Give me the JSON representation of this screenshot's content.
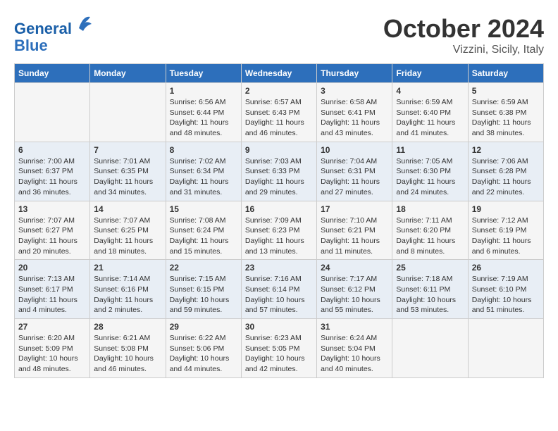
{
  "header": {
    "logo_line1": "General",
    "logo_line2": "Blue",
    "month": "October 2024",
    "location": "Vizzini, Sicily, Italy"
  },
  "weekdays": [
    "Sunday",
    "Monday",
    "Tuesday",
    "Wednesday",
    "Thursday",
    "Friday",
    "Saturday"
  ],
  "weeks": [
    [
      {
        "day": "",
        "info": ""
      },
      {
        "day": "",
        "info": ""
      },
      {
        "day": "1",
        "info": "Sunrise: 6:56 AM\nSunset: 6:44 PM\nDaylight: 11 hours\nand 48 minutes."
      },
      {
        "day": "2",
        "info": "Sunrise: 6:57 AM\nSunset: 6:43 PM\nDaylight: 11 hours\nand 46 minutes."
      },
      {
        "day": "3",
        "info": "Sunrise: 6:58 AM\nSunset: 6:41 PM\nDaylight: 11 hours\nand 43 minutes."
      },
      {
        "day": "4",
        "info": "Sunrise: 6:59 AM\nSunset: 6:40 PM\nDaylight: 11 hours\nand 41 minutes."
      },
      {
        "day": "5",
        "info": "Sunrise: 6:59 AM\nSunset: 6:38 PM\nDaylight: 11 hours\nand 38 minutes."
      }
    ],
    [
      {
        "day": "6",
        "info": "Sunrise: 7:00 AM\nSunset: 6:37 PM\nDaylight: 11 hours\nand 36 minutes."
      },
      {
        "day": "7",
        "info": "Sunrise: 7:01 AM\nSunset: 6:35 PM\nDaylight: 11 hours\nand 34 minutes."
      },
      {
        "day": "8",
        "info": "Sunrise: 7:02 AM\nSunset: 6:34 PM\nDaylight: 11 hours\nand 31 minutes."
      },
      {
        "day": "9",
        "info": "Sunrise: 7:03 AM\nSunset: 6:33 PM\nDaylight: 11 hours\nand 29 minutes."
      },
      {
        "day": "10",
        "info": "Sunrise: 7:04 AM\nSunset: 6:31 PM\nDaylight: 11 hours\nand 27 minutes."
      },
      {
        "day": "11",
        "info": "Sunrise: 7:05 AM\nSunset: 6:30 PM\nDaylight: 11 hours\nand 24 minutes."
      },
      {
        "day": "12",
        "info": "Sunrise: 7:06 AM\nSunset: 6:28 PM\nDaylight: 11 hours\nand 22 minutes."
      }
    ],
    [
      {
        "day": "13",
        "info": "Sunrise: 7:07 AM\nSunset: 6:27 PM\nDaylight: 11 hours\nand 20 minutes."
      },
      {
        "day": "14",
        "info": "Sunrise: 7:07 AM\nSunset: 6:25 PM\nDaylight: 11 hours\nand 18 minutes."
      },
      {
        "day": "15",
        "info": "Sunrise: 7:08 AM\nSunset: 6:24 PM\nDaylight: 11 hours\nand 15 minutes."
      },
      {
        "day": "16",
        "info": "Sunrise: 7:09 AM\nSunset: 6:23 PM\nDaylight: 11 hours\nand 13 minutes."
      },
      {
        "day": "17",
        "info": "Sunrise: 7:10 AM\nSunset: 6:21 PM\nDaylight: 11 hours\nand 11 minutes."
      },
      {
        "day": "18",
        "info": "Sunrise: 7:11 AM\nSunset: 6:20 PM\nDaylight: 11 hours\nand 8 minutes."
      },
      {
        "day": "19",
        "info": "Sunrise: 7:12 AM\nSunset: 6:19 PM\nDaylight: 11 hours\nand 6 minutes."
      }
    ],
    [
      {
        "day": "20",
        "info": "Sunrise: 7:13 AM\nSunset: 6:17 PM\nDaylight: 11 hours\nand 4 minutes."
      },
      {
        "day": "21",
        "info": "Sunrise: 7:14 AM\nSunset: 6:16 PM\nDaylight: 11 hours\nand 2 minutes."
      },
      {
        "day": "22",
        "info": "Sunrise: 7:15 AM\nSunset: 6:15 PM\nDaylight: 10 hours\nand 59 minutes."
      },
      {
        "day": "23",
        "info": "Sunrise: 7:16 AM\nSunset: 6:14 PM\nDaylight: 10 hours\nand 57 minutes."
      },
      {
        "day": "24",
        "info": "Sunrise: 7:17 AM\nSunset: 6:12 PM\nDaylight: 10 hours\nand 55 minutes."
      },
      {
        "day": "25",
        "info": "Sunrise: 7:18 AM\nSunset: 6:11 PM\nDaylight: 10 hours\nand 53 minutes."
      },
      {
        "day": "26",
        "info": "Sunrise: 7:19 AM\nSunset: 6:10 PM\nDaylight: 10 hours\nand 51 minutes."
      }
    ],
    [
      {
        "day": "27",
        "info": "Sunrise: 6:20 AM\nSunset: 5:09 PM\nDaylight: 10 hours\nand 48 minutes."
      },
      {
        "day": "28",
        "info": "Sunrise: 6:21 AM\nSunset: 5:08 PM\nDaylight: 10 hours\nand 46 minutes."
      },
      {
        "day": "29",
        "info": "Sunrise: 6:22 AM\nSunset: 5:06 PM\nDaylight: 10 hours\nand 44 minutes."
      },
      {
        "day": "30",
        "info": "Sunrise: 6:23 AM\nSunset: 5:05 PM\nDaylight: 10 hours\nand 42 minutes."
      },
      {
        "day": "31",
        "info": "Sunrise: 6:24 AM\nSunset: 5:04 PM\nDaylight: 10 hours\nand 40 minutes."
      },
      {
        "day": "",
        "info": ""
      },
      {
        "day": "",
        "info": ""
      }
    ]
  ]
}
